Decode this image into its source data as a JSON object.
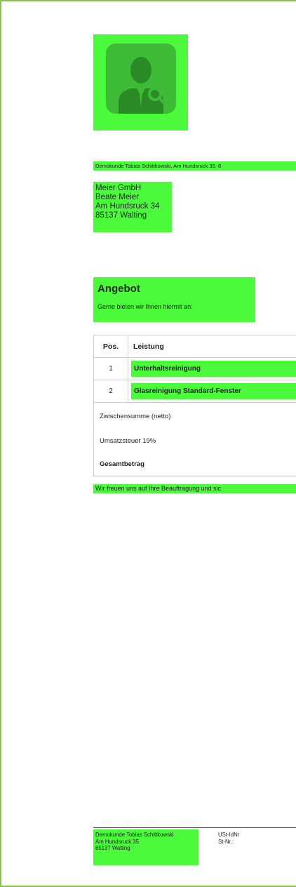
{
  "sender_line": "Demokunde Tobias Schittkowski, Am Hundsruck 35, 8",
  "recipient": {
    "company": "Meier GmbH",
    "person": "Beate Meier",
    "street": "Am Hundsruck 34",
    "city": "85137 Walting"
  },
  "offer": {
    "title": "Angebot",
    "intro": "Gerne bieten wir Ihnen hiermit an:"
  },
  "table": {
    "headers": {
      "pos": "Pos.",
      "service": "Leistung"
    },
    "rows": [
      {
        "pos": "1",
        "service": "Unterhaltsreinigung"
      },
      {
        "pos": "2",
        "service": "Glasreinigung Standard-Fenster"
      }
    ],
    "subtotal": "Zwischensumme (netto)",
    "vat": "Umsatzsteuer 19%",
    "total": "Gesamtbetrag"
  },
  "closing": "Wir freuen uns auf Ihre Beauftragung und sic",
  "footer": {
    "address": [
      "Demokunde Tobias Schittkowski",
      "Am Hundsruck 35",
      "85137 Walting"
    ],
    "vat_id_label": "USt-IdNr",
    "tax_no_label": "St-Nr.:"
  },
  "colors": {
    "highlight": "#4cfa3c",
    "page_border": "#8bc34a",
    "logo_tile": "#3dbb36"
  },
  "icons": {
    "logo": "business-person-search-icon"
  }
}
